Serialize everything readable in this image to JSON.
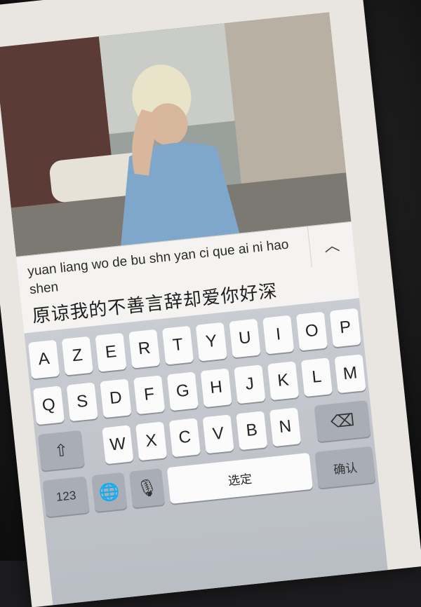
{
  "message": {
    "pinyin_text": "yuan liang wo de bu shn yan ci que ai ni hao shen",
    "collapse_icon": "chevron-up-icon"
  },
  "input": {
    "candidate_text": "原谅我的不善言辞却爱你好深"
  },
  "keyboard": {
    "row1": [
      "A",
      "Z",
      "E",
      "R",
      "T",
      "Y",
      "U",
      "I",
      "O",
      "P"
    ],
    "row2": [
      "Q",
      "S",
      "D",
      "F",
      "G",
      "H",
      "J",
      "K",
      "L",
      "M"
    ],
    "row3": [
      "W",
      "X",
      "C",
      "V",
      "B",
      "N"
    ],
    "shift_icon": "shift-icon",
    "delete_icon": "backspace-icon",
    "confirm_label": "确认",
    "numbers_label": "123",
    "globe_icon": "globe-icon",
    "mic_icon": "microphone-icon",
    "space_label": "选定"
  }
}
